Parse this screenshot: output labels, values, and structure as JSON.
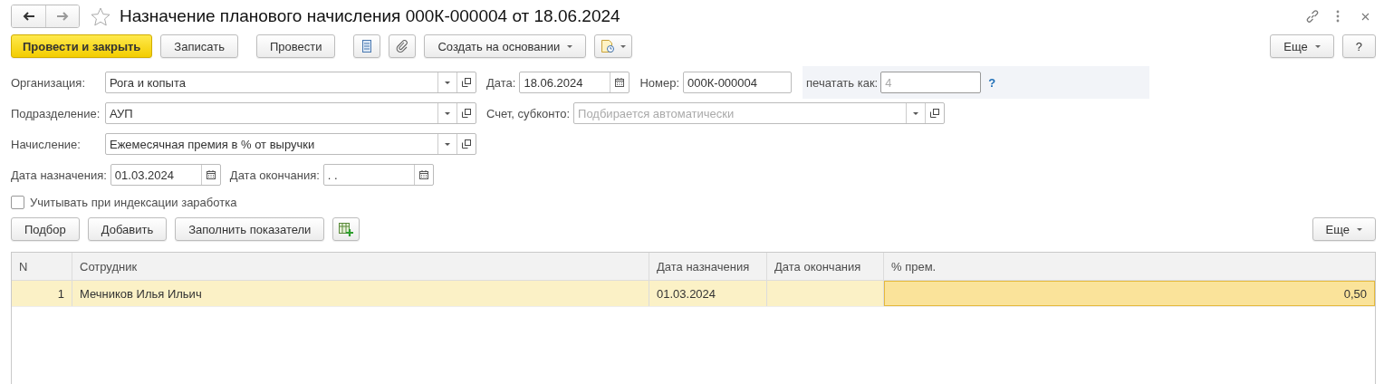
{
  "window": {
    "title": "Назначение планового начисления 000К-000004 от 18.06.2024",
    "favorite": false
  },
  "toolbar": {
    "buttons": [
      {
        "label": "Провести и закрыть",
        "kind": "default"
      },
      {
        "label": "Записать",
        "kind": "plain"
      },
      {
        "label": "Провести",
        "kind": "plain"
      },
      {
        "kind": "list-icon"
      },
      {
        "kind": "clip-icon"
      },
      {
        "label": "Создать на основании",
        "kind": "menu"
      },
      {
        "kind": "report-icon"
      }
    ],
    "right": [
      {
        "label": "Еще",
        "kind": "menu"
      },
      {
        "label": "?",
        "kind": "plain"
      }
    ]
  },
  "rows": [
    [
      {
        "label": "Организация:",
        "kind": "select",
        "value": "Рога и копыта"
      },
      {
        "label": "Дата:",
        "kind": "date",
        "value": "18.06.2024"
      },
      {
        "label": "Номер:",
        "kind": "text",
        "value": "000К-000004"
      }
    ],
    [
      {
        "label": "Подразделение:",
        "kind": "select",
        "value": "АУП"
      },
      {
        "label": "Счет, субконто:",
        "kind": "select",
        "placeholder": "Подбирается автоматически"
      }
    ],
    [
      {
        "label": "Начисление:",
        "kind": "select",
        "value": "Ежемесячная премия в % от выручки"
      }
    ]
  ],
  "print_as": {
    "label": "печатать как:",
    "placeholder": "4",
    "help": "?"
  },
  "dates": [
    {
      "label": "Дата назначения:",
      "kind": "date",
      "value": "01.03.2024"
    },
    {
      "label": "Дата окончания:",
      "kind": "date",
      "value": " .  ."
    }
  ],
  "indexing": {
    "label": "Учитывать при индексации заработка",
    "checked": false
  },
  "table_toolbar": {
    "buttons": [
      {
        "label": "Подбор",
        "kind": "plain"
      },
      {
        "label": "Добавить",
        "kind": "plain"
      },
      {
        "label": "Заполнить показатели",
        "kind": "plain"
      },
      {
        "kind": "add-table-icon"
      }
    ],
    "right": [
      {
        "label": "Еще",
        "kind": "menu"
      }
    ]
  },
  "table": {
    "columns": [
      "N",
      "Сотрудник",
      "Дата назначения",
      "Дата окончания",
      "% прем."
    ],
    "rows": [
      {
        "selected": true,
        "cells": [
          {
            "text": "1",
            "focused": false
          },
          {
            "text": "Мечников Илья Ильич",
            "focused": false
          },
          {
            "text": "01.03.2024",
            "focused": false
          },
          {
            "text": "",
            "focused": false
          },
          {
            "text": "0,50",
            "focused": true
          }
        ]
      }
    ]
  }
}
